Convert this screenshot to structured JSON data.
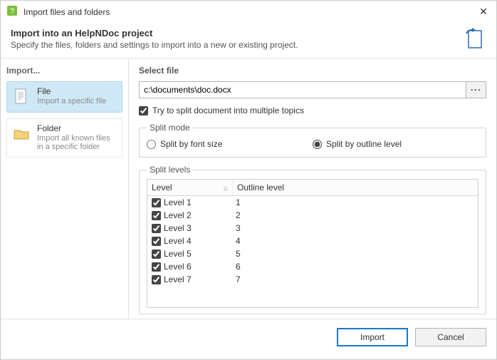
{
  "window": {
    "title": "Import files and folders",
    "close_glyph": "✕"
  },
  "header": {
    "title": "Import into an HelpNDoc project",
    "subtitle": "Specify the files, folders and settings to import into a new or existing project."
  },
  "sidebar": {
    "heading": "Import...",
    "items": [
      {
        "label": "File",
        "desc": "Import a specific file",
        "selected": true
      },
      {
        "label": "Folder",
        "desc": "Import all known files in a specific folder",
        "selected": false
      }
    ]
  },
  "main": {
    "select_file_heading": "Select file",
    "file_path_value": "c:\\documents\\doc.docx",
    "browse_button_glyph": "···",
    "split_checkbox_label": "Try to split document into multiple topics",
    "split_checkbox_checked": true,
    "split_mode": {
      "legend": "Split mode",
      "options": [
        {
          "label": "Split by font size",
          "checked": false
        },
        {
          "label": "Split by outline level",
          "checked": true
        }
      ]
    },
    "split_levels": {
      "legend": "Split levels",
      "columns": {
        "level": "Level",
        "outline": "Outline level"
      },
      "rows": [
        {
          "label": "Level 1",
          "outline": "1",
          "checked": true
        },
        {
          "label": "Level 2",
          "outline": "2",
          "checked": true
        },
        {
          "label": "Level 3",
          "outline": "3",
          "checked": true
        },
        {
          "label": "Level 4",
          "outline": "4",
          "checked": true
        },
        {
          "label": "Level 5",
          "outline": "5",
          "checked": true
        },
        {
          "label": "Level 6",
          "outline": "6",
          "checked": true
        },
        {
          "label": "Level 7",
          "outline": "7",
          "checked": true
        }
      ]
    }
  },
  "footer": {
    "import_label": "Import",
    "cancel_label": "Cancel"
  }
}
